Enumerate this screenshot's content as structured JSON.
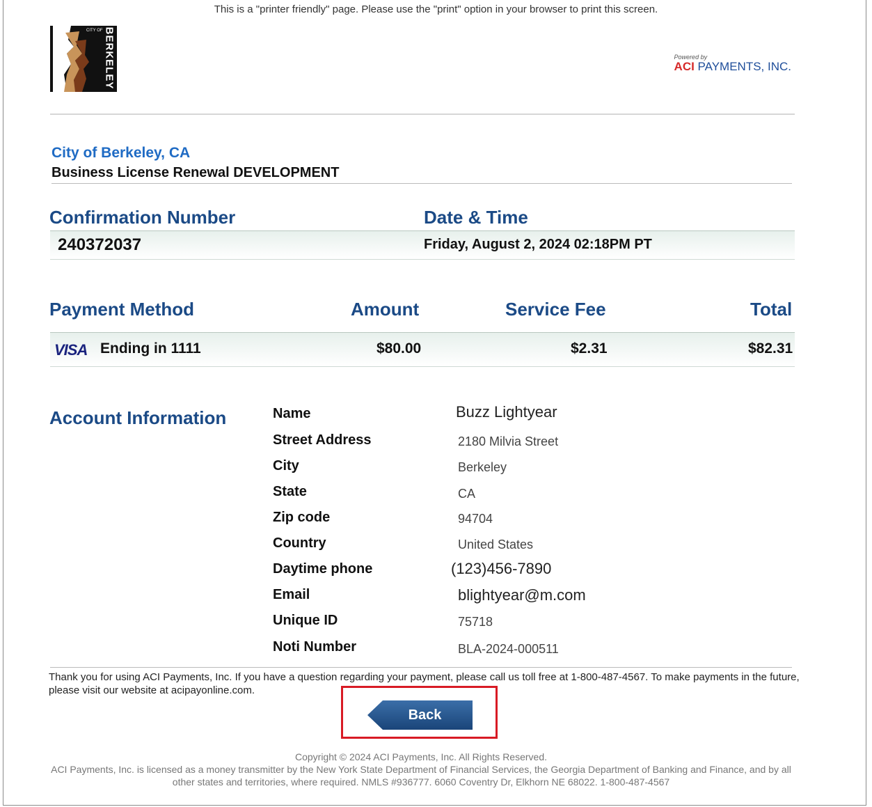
{
  "notice": "This is a \"printer friendly\" page. Please use the \"print\" option in your browser to print this screen.",
  "logo": {
    "small": "CITY OF",
    "word": "BERKELEY"
  },
  "aci": {
    "powered_by": "Powered by",
    "brand_bold": "ACI",
    "brand_rest": " PAYMENTS, INC."
  },
  "merchant": "City of Berkeley, CA",
  "service": "Business License Renewal DEVELOPMENT",
  "confirmation": {
    "number_label": "Confirmation Number",
    "datetime_label": "Date & Time",
    "number": "240372037",
    "datetime": "Friday, August 2, 2024 02:18PM PT"
  },
  "payment": {
    "method_label": "Payment Method",
    "amount_label": "Amount",
    "fee_label": "Service Fee",
    "total_label": "Total",
    "card_brand": "VISA",
    "card_text": "Ending in 1111",
    "amount": "$80.00",
    "fee": "$2.31",
    "total": "$82.31"
  },
  "account": {
    "heading": "Account Information",
    "fields": [
      {
        "label": "Name",
        "value": "Buzz Lightyear"
      },
      {
        "label": "Street Address",
        "value": "2180 Milvia Street"
      },
      {
        "label": "City",
        "value": "Berkeley"
      },
      {
        "label": "State",
        "value": "CA"
      },
      {
        "label": "Zip code",
        "value": "94704"
      },
      {
        "label": "Country",
        "value": "United States"
      },
      {
        "label": "Daytime phone",
        "value": "(123)456-7890"
      },
      {
        "label": "Email",
        "value": "blightyear@m.com"
      },
      {
        "label": "Unique ID",
        "value": "75718"
      },
      {
        "label": "Noti Number",
        "value": "BLA-2024-000511"
      }
    ]
  },
  "footer": {
    "thanks": "Thank you for using ACI Payments, Inc. If you have a question regarding your payment, please call us toll free at 1-800-487-4567. To make payments in the future, please visit our website at acipayonline.com.",
    "back_label": "Back",
    "copyright": "Copyright © 2024 ACI Payments, Inc. All Rights Reserved.",
    "license": "ACI Payments, Inc. is licensed as a money transmitter by the New York State Department of Financial Services, the Georgia Department of Banking and Finance, and by all other states and territories, where required. NMLS #936777. 6060 Coventry Dr, Elkhorn NE 68022. 1-800-487-4567"
  },
  "colors": {
    "heading": "#1b4a86",
    "merchant": "#1f6bc4",
    "highlight": "#d81b25"
  }
}
